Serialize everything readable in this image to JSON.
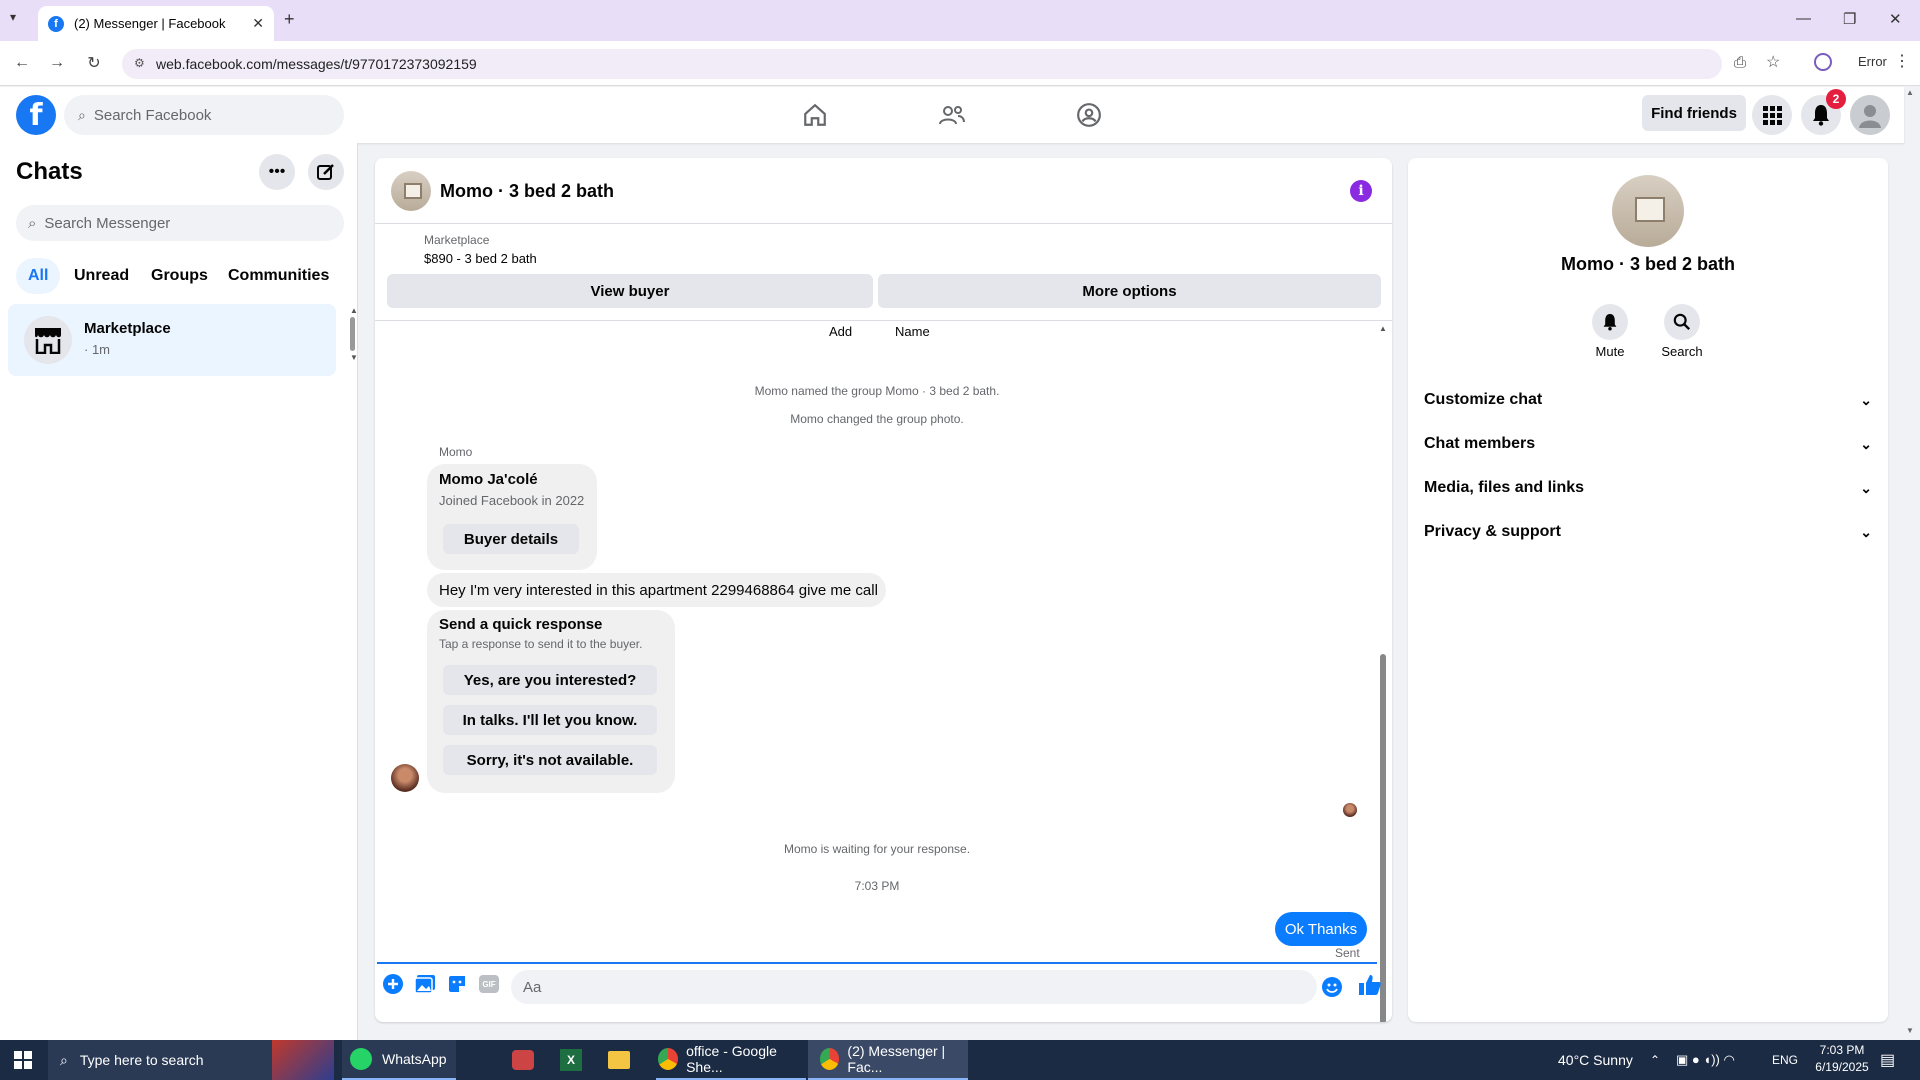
{
  "browser": {
    "tab_title": "(2) Messenger | Facebook",
    "url": "web.facebook.com/messages/t/9770172373092159",
    "profile_status": "Error"
  },
  "header": {
    "search_placeholder": "Search Facebook",
    "find_friends": "Find friends",
    "notification_count": "2"
  },
  "sidebar": {
    "title": "Chats",
    "search_placeholder": "Search Messenger",
    "filters": [
      "All",
      "Unread",
      "Groups",
      "Communities"
    ],
    "chat": {
      "name": "Marketplace",
      "time": "· 1m"
    }
  },
  "conversation": {
    "title": "Momo · 3 bed 2 bath",
    "marketplace_label": "Marketplace",
    "listing": "$890 - 3 bed 2 bath",
    "view_buyer": "View buyer",
    "more_options": "More options",
    "top_labels": {
      "add": "Add",
      "name": "Name"
    },
    "system_messages": [
      "Momo named the group Momo · 3 bed 2 bath.",
      "Momo changed the group photo."
    ],
    "sender_name": "Momo",
    "buyer_card": {
      "name": "Momo Ja'colé",
      "joined": "Joined Facebook in 2022",
      "button": "Buyer details"
    },
    "message": "Hey I'm very interested in this apartment 2299468864 give me call",
    "quick_response": {
      "title": "Send a quick response",
      "subtitle": "Tap a response to send it to the buyer.",
      "options": [
        "Yes, are you interested?",
        "In talks. I'll let you know.",
        "Sorry, it's not available."
      ]
    },
    "waiting": "Momo is waiting for your response.",
    "timestamp": "7:03 PM",
    "my_message": "Ok Thanks",
    "sent_status": "Sent",
    "composer_placeholder": "Aa"
  },
  "details": {
    "name": "Momo · 3 bed 2 bath",
    "mute": "Mute",
    "search": "Search",
    "sections": [
      "Customize chat",
      "Chat members",
      "Media, files and links",
      "Privacy & support"
    ]
  },
  "taskbar": {
    "search_placeholder": "Type here to search",
    "apps": [
      "WhatsApp",
      "office - Google She...",
      "(2) Messenger | Fac..."
    ],
    "weather": "40°C  Sunny",
    "lang": "ENG",
    "time": "7:03 PM",
    "date": "6/19/2025"
  },
  "colors": {
    "brand": "#1877f2",
    "accent_purple": "#8a2be2"
  }
}
